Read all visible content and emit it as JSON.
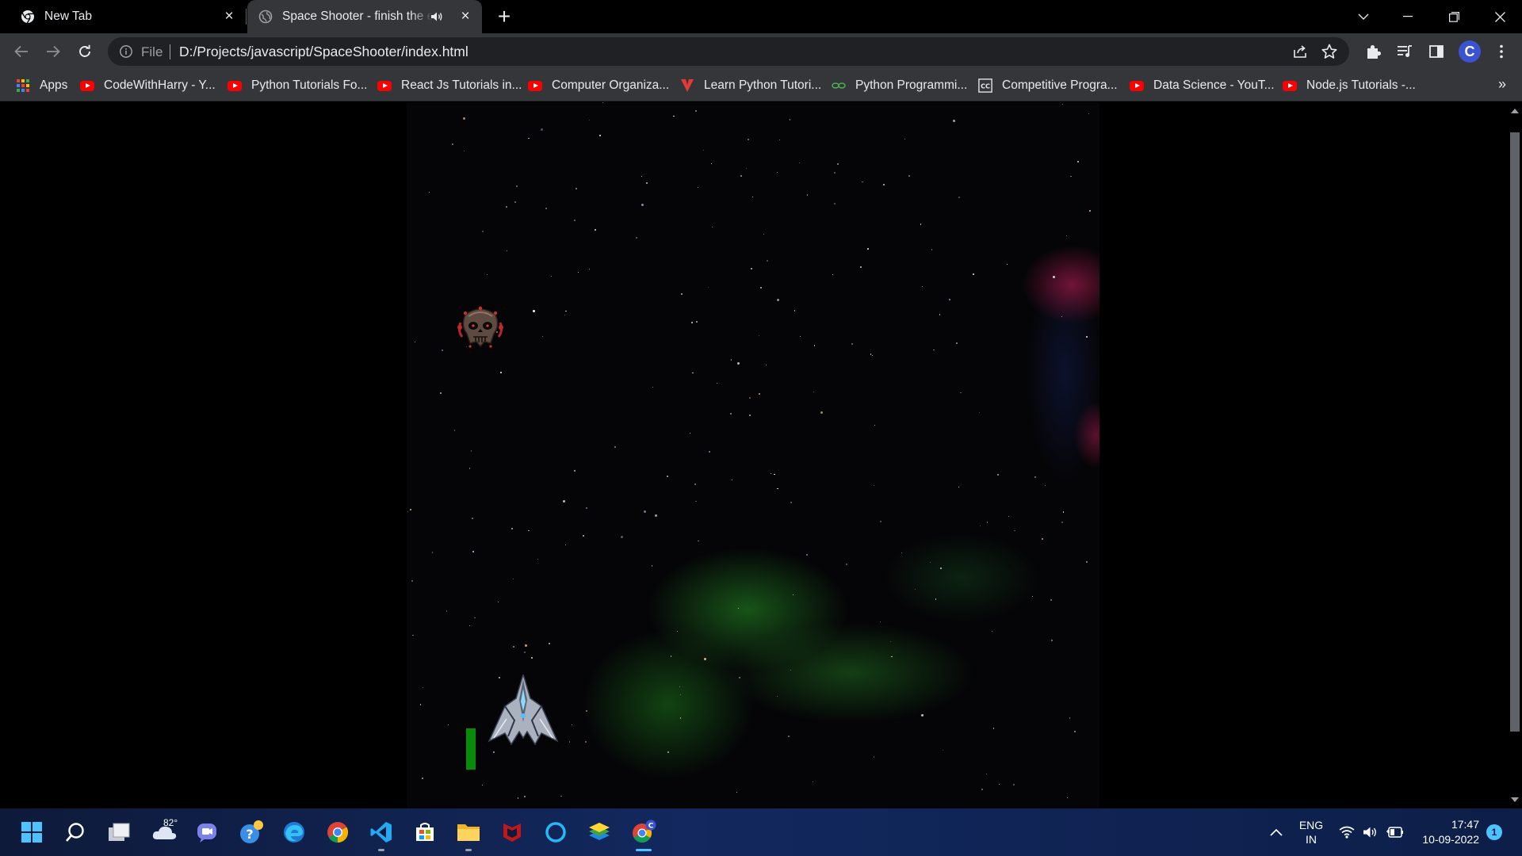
{
  "browser": {
    "tabs": [
      {
        "title": "New Tab",
        "icon": "chrome-icon"
      },
      {
        "title": "Space Shooter - finish the enemy",
        "icon": "globe-icon",
        "audio": true
      }
    ],
    "address_bar": {
      "scheme_label": "File",
      "url": "D:/Projects/javascript/SpaceShooter/index.html"
    },
    "profile_initial": "C",
    "bookmarks": [
      {
        "label": "Apps",
        "icon": "apps-grid-icon"
      },
      {
        "label": "CodeWithHarry - Y...",
        "icon": "youtube-icon"
      },
      {
        "label": "Python Tutorials Fo...",
        "icon": "youtube-icon"
      },
      {
        "label": "React Js Tutorials in...",
        "icon": "youtube-icon"
      },
      {
        "label": "Computer Organiza...",
        "icon": "youtube-icon"
      },
      {
        "label": "Learn Python Tutori...",
        "icon": "red-v-icon"
      },
      {
        "label": "Python Programmi...",
        "icon": "green-link-icon"
      },
      {
        "label": "Competitive Progra...",
        "icon": "cc-icon"
      },
      {
        "label": "Data Science - YouT...",
        "icon": "youtube-icon"
      },
      {
        "label": "Node.js Tutorials -...",
        "icon": "youtube-icon"
      }
    ],
    "bookmarks_overflow": "»"
  },
  "game": {
    "player_health_fraction": 0.35,
    "colors": {
      "health_bar": "#0a8a0a",
      "nebula_green": "#1e6e1e",
      "nebula_pink": "#c81e5a"
    }
  },
  "taskbar": {
    "weather_temp": "82°",
    "apps": [
      "windows-start-icon",
      "search-icon",
      "task-view-icon",
      "weather-icon",
      "teams-chat-icon",
      "help-icon",
      "edge-icon",
      "chrome-icon",
      "vscode-icon",
      "store-icon",
      "file-explorer-icon",
      "mcafee-icon",
      "cortana-icon",
      "stack-icon",
      "chrome-profile-icon"
    ],
    "language": {
      "line1": "ENG",
      "line2": "IN"
    },
    "time": "17:47",
    "date": "10-09-2022",
    "notification_count": "1"
  }
}
